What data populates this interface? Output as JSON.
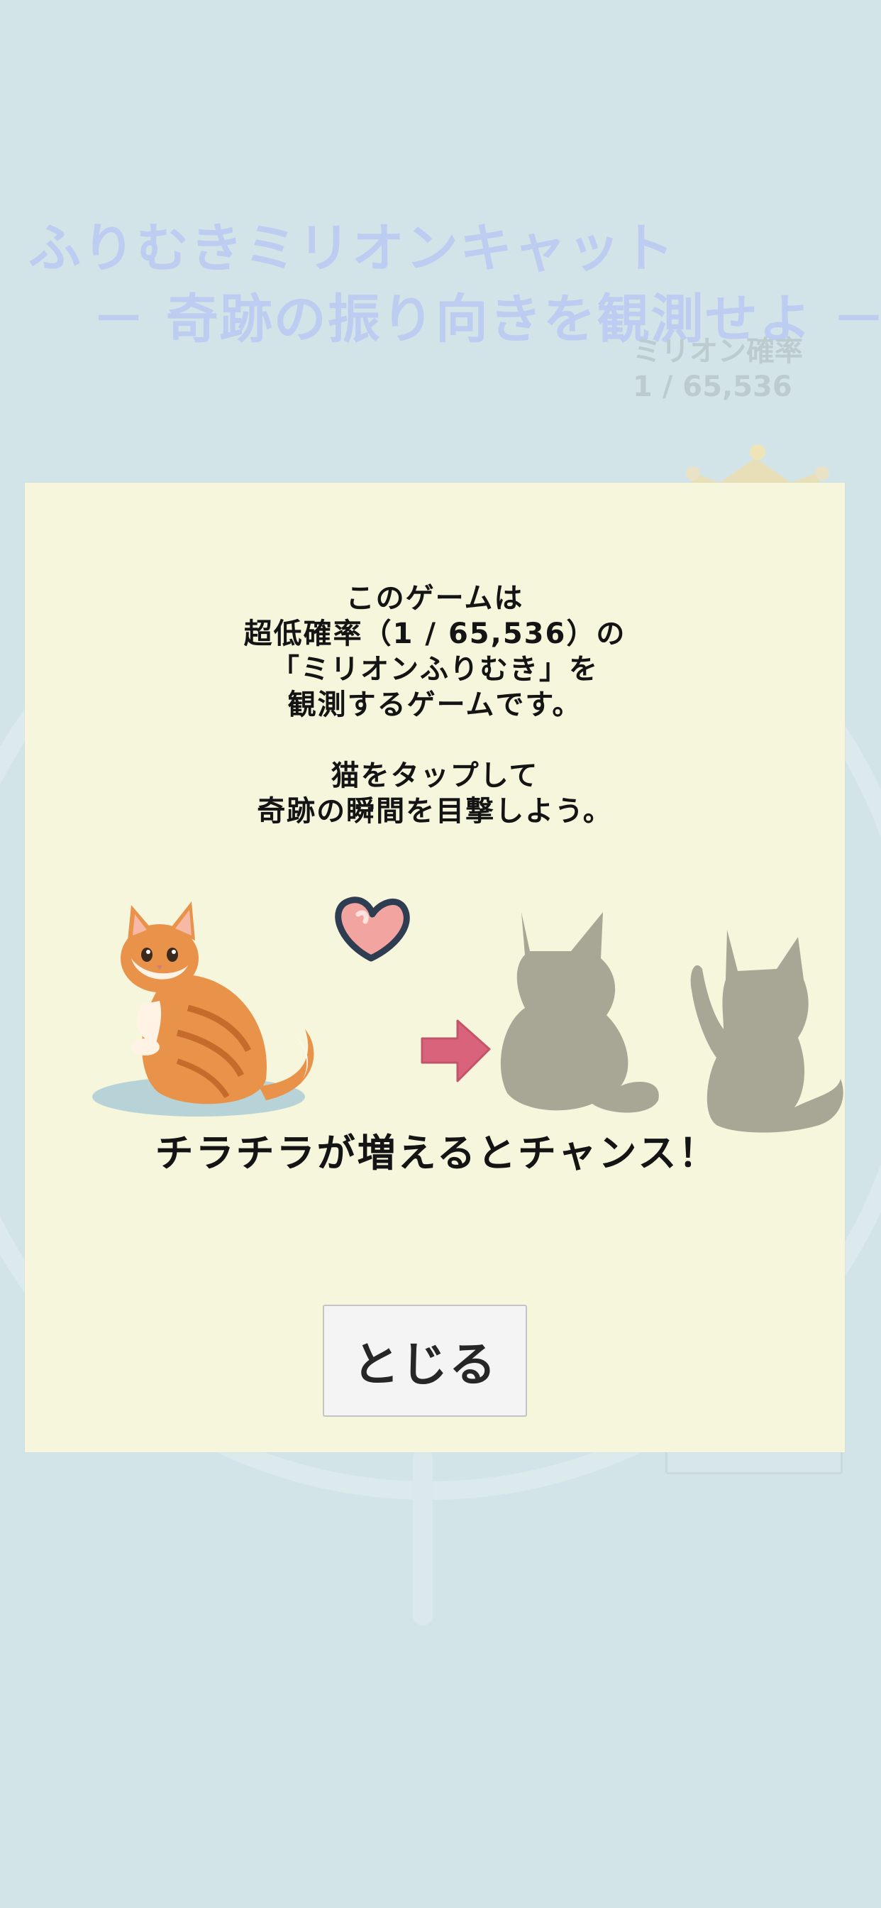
{
  "background": {
    "title_line1": "ふりむきミリオンキャット",
    "title_line2": "－ 奇跡の振り向きを観測せよ －",
    "probability_label": "ミリオン確率",
    "probability_value": "1 / 65,536"
  },
  "modal": {
    "description_lines": [
      "このゲームは",
      "超低確率（1 / 65,536）の",
      "「ミリオンふりむき」を",
      "観測するゲームです。",
      "",
      "猫をタップして",
      "奇跡の瞬間を目撃しよう。"
    ],
    "chance_text": "チラチラが増えるとチャンス！",
    "close_label": "とじる"
  },
  "colors": {
    "page_background": "#d3e4e8",
    "modal_background": "#f5f6dc",
    "title_color": "#bccdf1",
    "cat_orange": "#e8924a",
    "silhouette": "#a8a796",
    "arrow": "#d9637a",
    "heart": "#f2a5a0"
  },
  "icons": {
    "heart": "heart-icon",
    "arrow": "arrow-right-icon",
    "crown": "crown-icon"
  }
}
